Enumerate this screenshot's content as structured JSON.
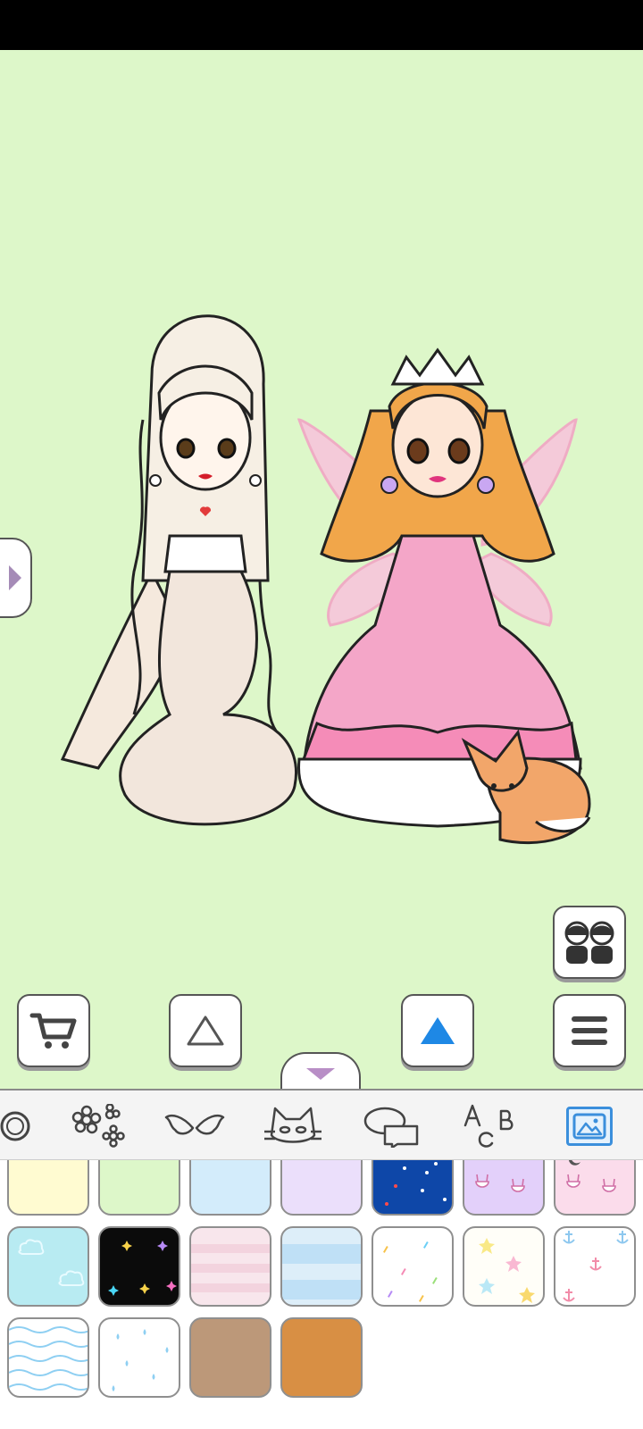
{
  "status_bar": {},
  "scene": {
    "background_color": "#ddf7c9",
    "characters": [
      {
        "name": "lamia-girl",
        "hair": "#f6efe4",
        "tail": "#f2e6dc"
      },
      {
        "name": "fairy-princess",
        "hair": "#f1a64a",
        "dress": "#f4a6c8",
        "wings": "#f9c3dc"
      }
    ],
    "pet": {
      "name": "fox",
      "color": "#f2a66a"
    }
  },
  "controls": {
    "side_toggle": {
      "icon": "play-right-icon"
    },
    "pair_button": {
      "icon": "two-dolls-icon"
    },
    "cart_button": {
      "icon": "shopping-cart-icon"
    },
    "layer_up_outline": {
      "icon": "triangle-up-outline-icon"
    },
    "layer_up_filled": {
      "icon": "triangle-up-filled-icon",
      "color": "#1e88e5"
    },
    "menu_button": {
      "icon": "hamburger-menu-icon"
    },
    "collapse_panel": {
      "icon": "chevron-down-icon",
      "color": "#b88ec6"
    }
  },
  "categories": [
    {
      "name": "accessory",
      "icon": "ring-icon"
    },
    {
      "name": "flowers",
      "icon": "flowers-icon"
    },
    {
      "name": "wings",
      "icon": "wings-icon"
    },
    {
      "name": "pets",
      "icon": "cat-icon"
    },
    {
      "name": "speech",
      "icon": "speech-bubbles-icon"
    },
    {
      "name": "text",
      "icon": "abc-letters-icon"
    },
    {
      "name": "background",
      "icon": "picture-icon",
      "selected": true
    }
  ],
  "swatches": [
    {
      "pattern": "solid",
      "color": "#fffbd1"
    },
    {
      "pattern": "solid",
      "color": "#ddf7c9"
    },
    {
      "pattern": "solid",
      "color": "#d3ecfb"
    },
    {
      "pattern": "solid",
      "color": "#ebdffb"
    },
    {
      "pattern": "stars-night",
      "color": "#0e47a8"
    },
    {
      "pattern": "bunnies",
      "color": "#e3d0fa"
    },
    {
      "pattern": "moons-bunnies",
      "color": "#fbdceb"
    },
    {
      "pattern": "clouds",
      "color": "#b8ebf2"
    },
    {
      "pattern": "sparkles-black",
      "color": "#0b0b0b"
    },
    {
      "pattern": "soft-stripes",
      "color": "#f8e6ec"
    },
    {
      "pattern": "blue-stripes",
      "color": "#ddeef9"
    },
    {
      "pattern": "confetti",
      "color": "#ffffff"
    },
    {
      "pattern": "starfish",
      "color": "#fffef8"
    },
    {
      "pattern": "anchors",
      "color": "#ffffff"
    },
    {
      "pattern": "waves",
      "color": "#ffffff"
    },
    {
      "pattern": "raindrops",
      "color": "#ffffff"
    },
    {
      "pattern": "solid",
      "color": "#bc9879"
    },
    {
      "pattern": "solid",
      "color": "#d88f44"
    }
  ]
}
